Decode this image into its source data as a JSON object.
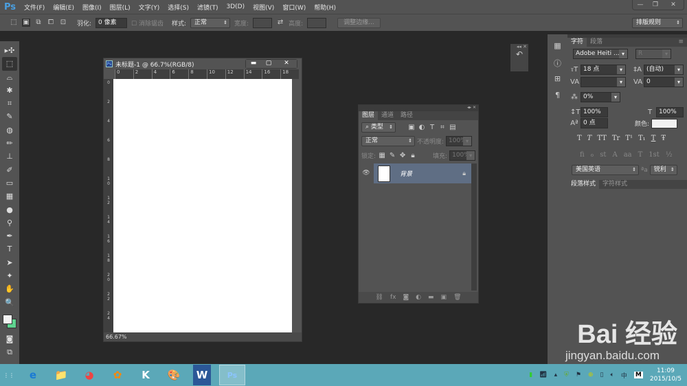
{
  "app": {
    "logo": "Ps",
    "menu": [
      "文件(F)",
      "编辑(E)",
      "图像(I)",
      "图层(L)",
      "文字(Y)",
      "选择(S)",
      "滤镜(T)",
      "3D(D)",
      "视图(V)",
      "窗口(W)",
      "帮助(H)"
    ],
    "win_buttons": [
      "—",
      "❐",
      "✕"
    ]
  },
  "options": {
    "feather_label": "羽化:",
    "feather_value": "0 像素",
    "antialias": "消除锯齿",
    "style_label": "样式:",
    "style_value": "正常",
    "width_label": "宽度:",
    "height_label": "高度:",
    "refine": "调整边缘...",
    "workspace": "排版规则"
  },
  "tools": [
    "▸✣",
    "⬚",
    "⌓",
    "✱",
    "⌗",
    "✎",
    "◍",
    "✏",
    "⊥",
    "✐",
    "▭",
    "▦",
    "●",
    "⚲",
    "✒",
    "T",
    "➤",
    "✦",
    "✋",
    "🔍"
  ],
  "document": {
    "title": "未标题-1 @ 66.7%(RGB/8)",
    "ps": "Ps",
    "buttons": [
      "▬",
      "▢",
      "✕"
    ],
    "hruler": [
      "0",
      "2",
      "4",
      "6",
      "8",
      "10",
      "12",
      "14",
      "16",
      "18"
    ],
    "vruler": [
      "0",
      "2",
      "4",
      "6",
      "8",
      "10",
      "12",
      "14",
      "16",
      "18",
      "20",
      "22",
      "24"
    ],
    "zoom": "66.67%"
  },
  "layers": {
    "tabs": [
      "图层",
      "通道",
      "路径"
    ],
    "filter": "⌕ 类型",
    "blend": "正常",
    "opacity_label": "不透明度:",
    "opacity": "100%",
    "lock_label": "锁定:",
    "fill_label": "填充:",
    "fill": "100%",
    "layer_name": "背景",
    "footer": [
      "⛓",
      "fx",
      "◙",
      "◐",
      "▬",
      "▣",
      "🗑"
    ]
  },
  "character": {
    "tabs": [
      "字符",
      "段落"
    ],
    "font": "Adobe Heiti ...",
    "style": "R",
    "size": "18 点",
    "leading": "(自动)",
    "tracking": "0",
    "scale": "0%",
    "vscale": "100%",
    "hscale": "100%",
    "baseline": "0 点",
    "color_label": "颜色:",
    "color": "#f2f2f2",
    "type_buttons": [
      "T",
      "T",
      "TT",
      "Tr",
      "T¹",
      "T₁",
      "T",
      "Ŧ"
    ],
    "ot_buttons": [
      "fi",
      "ℴ",
      "st",
      "A",
      "aa",
      "T",
      "1st",
      "½"
    ],
    "language": "美国英语",
    "aa_label": "ªa",
    "antialias": "锐利",
    "bottom_tabs": [
      "段落样式",
      "字符样式"
    ]
  },
  "taskbar": {
    "apps": [
      "e",
      "📁",
      "◕",
      "✿",
      "K",
      "🎨",
      "W",
      "Ps"
    ],
    "time": "11:09",
    "date": "2015/10/5",
    "ime": "中",
    "m": "M"
  },
  "watermark": {
    "main": "Bai 经验",
    "sub": "jingyan.baidu.com"
  }
}
